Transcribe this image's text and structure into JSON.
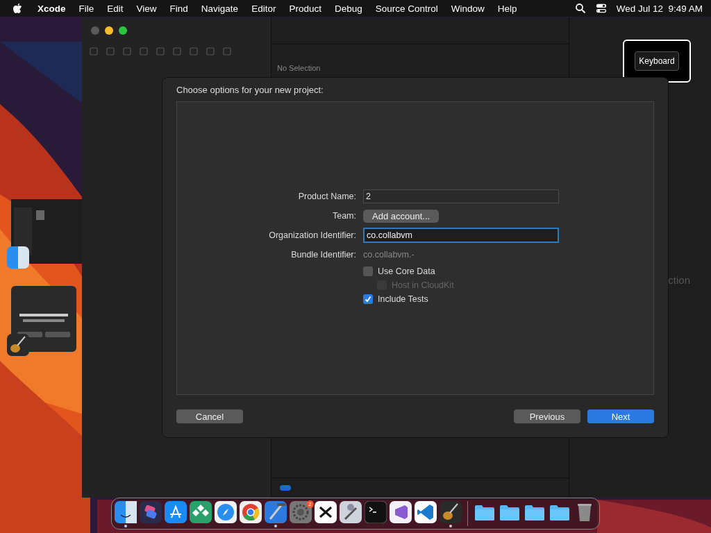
{
  "menu_bar": {
    "app": "Xcode",
    "menus": [
      "File",
      "Edit",
      "View",
      "Find",
      "Navigate",
      "Editor",
      "Product",
      "Debug",
      "Source Control",
      "Window",
      "Help"
    ],
    "clock": "Wed Jul 12  9:49 AM"
  },
  "xcode_window": {
    "editor_label": "No Selection",
    "inspector_label": "ction",
    "filter_on": true
  },
  "keyboard_overlay": {
    "label": "Keyboard"
  },
  "dialog": {
    "title": "Choose options for your new project:",
    "fields": [
      {
        "kind": "text",
        "label": "Product Name:",
        "value": "2",
        "focused": false
      },
      {
        "kind": "button",
        "label": "Team:",
        "value": "Add account..."
      },
      {
        "kind": "text",
        "label": "Organization Identifier:",
        "value": "co.collabvm",
        "focused": true
      },
      {
        "kind": "static",
        "label": "Bundle Identifier:",
        "value": "co.collabvm.-"
      }
    ],
    "checkboxes": [
      {
        "label": "Use Core Data",
        "checked": false,
        "disabled": false,
        "children": [
          {
            "label": "Host in CloudKit",
            "checked": false,
            "disabled": true
          }
        ]
      },
      {
        "label": "Include Tests",
        "checked": true,
        "disabled": false
      }
    ],
    "buttons": [
      {
        "label": "Cancel",
        "primary": false
      },
      {
        "label": "Previous",
        "primary": false
      },
      {
        "label": "Next",
        "primary": true
      }
    ]
  },
  "dock": {
    "items": [
      {
        "kind": "finder",
        "running": true
      },
      {
        "kind": "shortcuts",
        "running": false
      },
      {
        "kind": "appstore",
        "running": false
      },
      {
        "kind": "diamond",
        "running": false
      },
      {
        "kind": "safari",
        "running": false
      },
      {
        "kind": "chrome",
        "running": false
      },
      {
        "kind": "xcode",
        "running": true
      },
      {
        "kind": "settings",
        "running": false,
        "badge": "2"
      },
      {
        "kind": "capcut",
        "running": false
      },
      {
        "kind": "utility",
        "running": false
      },
      {
        "kind": "terminal",
        "running": false
      },
      {
        "kind": "visualstudio",
        "running": false
      },
      {
        "kind": "vscode",
        "running": false
      },
      {
        "kind": "guitar",
        "running": true
      },
      {
        "kind": "separator"
      },
      {
        "kind": "folder",
        "running": false
      },
      {
        "kind": "folder",
        "running": false
      },
      {
        "kind": "folder",
        "running": false
      },
      {
        "kind": "folder",
        "running": false
      },
      {
        "kind": "trash",
        "running": false
      }
    ]
  }
}
